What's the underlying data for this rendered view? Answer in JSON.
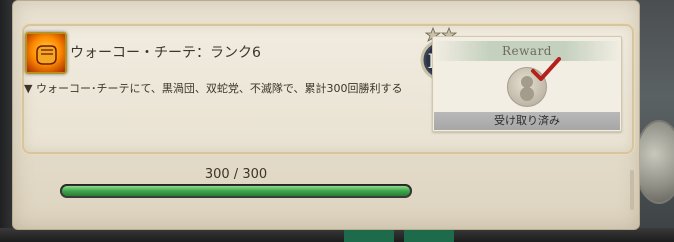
{
  "achievement": {
    "title": "ウォーコー・チーテ：ランク6",
    "description": "▼ ウォーコー･チーテにて、黒渦団、双蛇党、不滅隊で、累計300回勝利する",
    "icon": "fist-icon"
  },
  "medal": {
    "stars": 2,
    "rank_numeral": "IO"
  },
  "reward": {
    "header": "Reward",
    "status": "受け取り済み"
  },
  "progress": {
    "text": "300 / 300",
    "current": 300,
    "total": 300,
    "fraction": 1.0
  },
  "colors": {
    "progress_fill": "#3ea64a",
    "check_mark": "#b5201a",
    "parchment": "#e4dccb"
  }
}
